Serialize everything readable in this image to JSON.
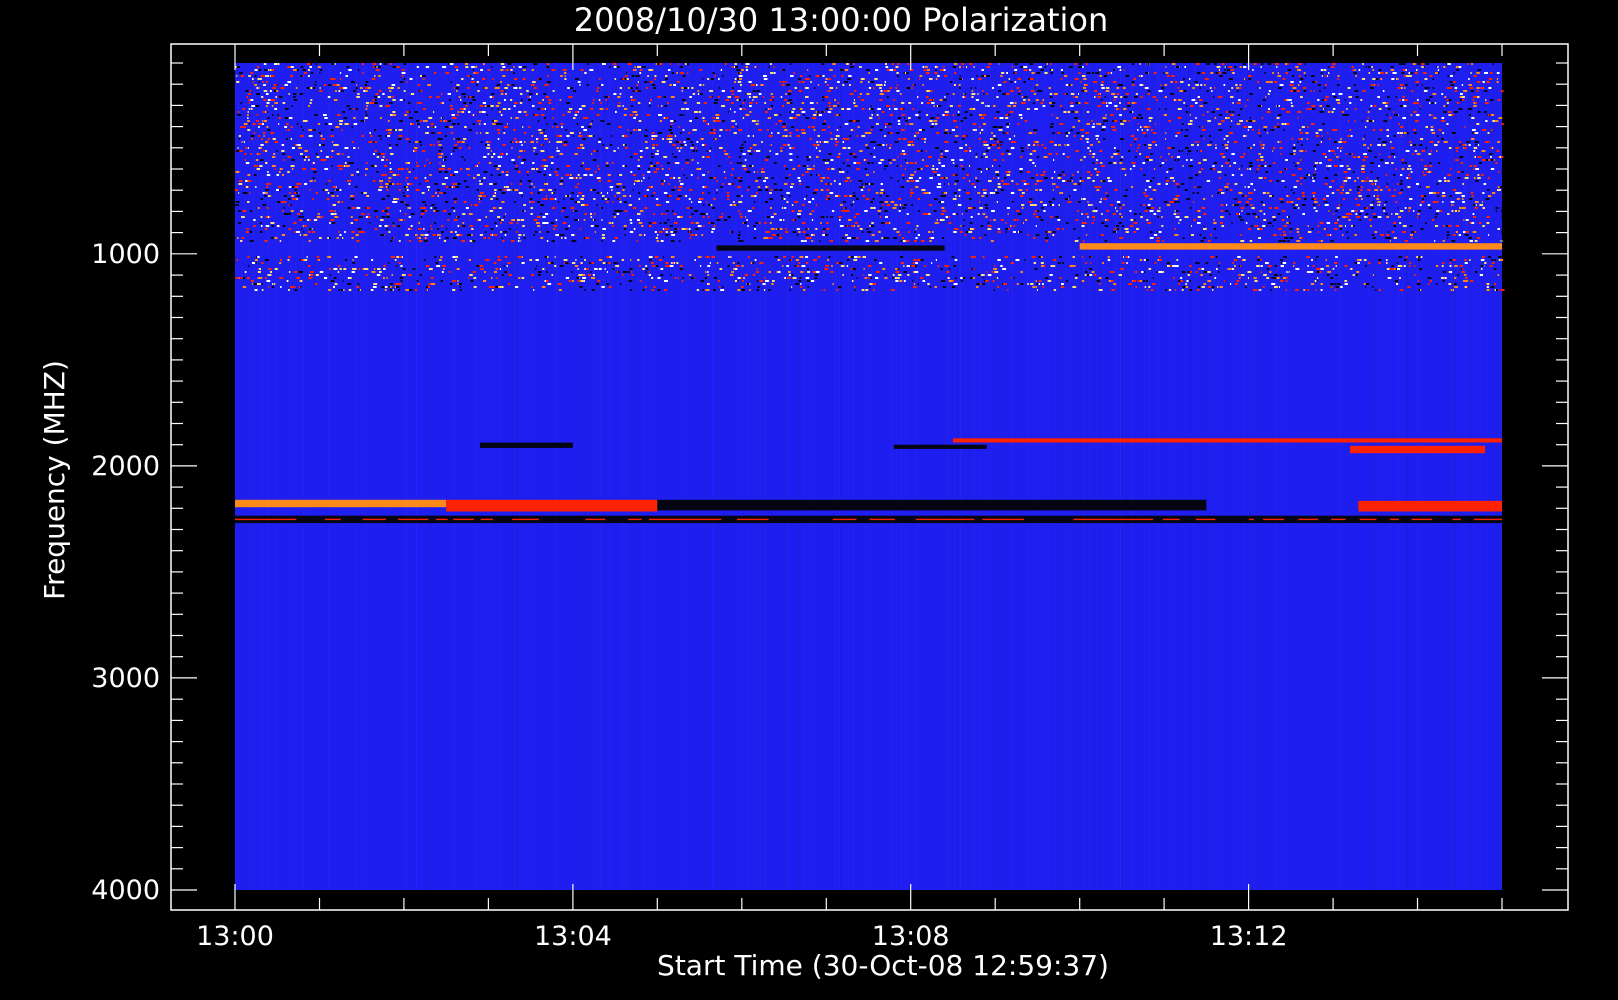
{
  "chart_data": {
    "type": "heatmap",
    "title": "2008/10/30 13:00:00 Polarization",
    "xlabel": "Start Time (30-Oct-08 12:59:37)",
    "ylabel": "Frequency (MHZ)",
    "x_range": [
      "13:00",
      "13:15"
    ],
    "x_ticks": [
      "13:00",
      "13:04",
      "13:08",
      "13:12"
    ],
    "y_range": [
      100,
      4000
    ],
    "y_ticks": [
      1000,
      2000,
      3000,
      4000
    ],
    "y_axis_inverted": true,
    "grid": false,
    "colors": {
      "background": "#000000",
      "base": "#1e1ef0",
      "red": "#ff2200",
      "orange": "#ff8a1a",
      "yellow": "#ffe070",
      "dark": "#050514",
      "white": "#ffffff"
    },
    "bands": [
      {
        "freq": [
          100,
          950
        ],
        "pattern": "speckle",
        "minutes": [
          0,
          15
        ]
      },
      {
        "freq": [
          950,
          980
        ],
        "pattern": "solid",
        "color": "orange",
        "minutes": [
          10,
          15
        ]
      },
      {
        "freq": [
          960,
          985
        ],
        "pattern": "solid",
        "color": "dark",
        "minutes": [
          5.7,
          8.4
        ]
      },
      {
        "freq": [
          1010,
          1180
        ],
        "pattern": "speckle",
        "minutes": [
          0,
          15
        ]
      },
      {
        "freq": [
          1870,
          1890
        ],
        "pattern": "solid",
        "color": "red",
        "minutes": [
          8.5,
          15
        ]
      },
      {
        "freq": [
          1890,
          1915
        ],
        "pattern": "solid",
        "color": "dark",
        "minutes": [
          2.9,
          4.0
        ]
      },
      {
        "freq": [
          1900,
          1920
        ],
        "pattern": "solid",
        "color": "dark",
        "minutes": [
          7.8,
          8.9
        ]
      },
      {
        "freq": [
          1905,
          1940
        ],
        "pattern": "solid",
        "color": "red",
        "minutes": [
          13.2,
          14.8
        ]
      },
      {
        "freq": [
          2160,
          2195
        ],
        "pattern": "solid",
        "color": "orange",
        "minutes": [
          0,
          2.5
        ]
      },
      {
        "freq": [
          2160,
          2215
        ],
        "pattern": "solid",
        "color": "red",
        "minutes": [
          2.5,
          5
        ]
      },
      {
        "freq": [
          2160,
          2210
        ],
        "pattern": "solid",
        "color": "dark",
        "minutes": [
          5,
          11.5
        ]
      },
      {
        "freq": [
          2165,
          2215
        ],
        "pattern": "solid",
        "color": "red",
        "minutes": [
          13.3,
          15
        ]
      },
      {
        "freq": [
          2235,
          2270
        ],
        "pattern": "segmented",
        "minutes": [
          0,
          15
        ]
      }
    ]
  }
}
